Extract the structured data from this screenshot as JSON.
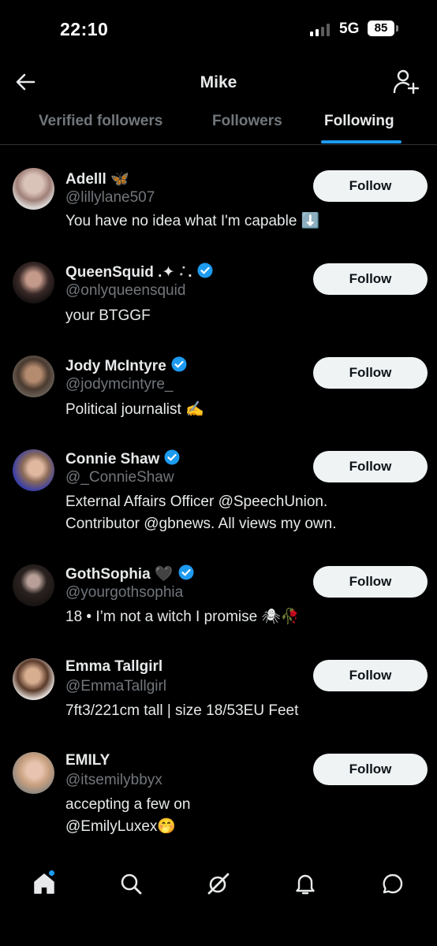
{
  "status_bar": {
    "time": "22:10",
    "network": "5G",
    "battery": "85"
  },
  "header": {
    "title": "Mike"
  },
  "tabs": [
    {
      "label": "Verified followers",
      "active": false
    },
    {
      "label": "Followers",
      "active": false
    },
    {
      "label": "Following",
      "active": true
    }
  ],
  "colors": {
    "accent": "#1d9bf0",
    "background": "#000000",
    "muted": "#71767b",
    "button_bg": "#eff3f4"
  },
  "users": [
    {
      "name": "Adelll 🦋",
      "handle": "@lillylane507",
      "bio": "You have no idea what I'm capable ⬇️",
      "verified": false,
      "follow_label": "Follow"
    },
    {
      "name": "QueenSquid .✦ ݁˖ .",
      "handle": "@onlyqueensquid",
      "bio": "your BTGGF",
      "verified": true,
      "follow_label": "Follow"
    },
    {
      "name": "Jody McIntyre",
      "handle": "@jodymcintyre_",
      "bio": "Political journalist ✍️",
      "verified": true,
      "follow_label": "Follow"
    },
    {
      "name": "Connie Shaw",
      "handle": "@_ConnieShaw",
      "bio": "External Affairs Officer @SpeechUnion. Contributor @gbnews. All views my own.",
      "verified": true,
      "follow_label": "Follow"
    },
    {
      "name": "GothSophia 🖤",
      "handle": "@yourgothsophia",
      "bio": "18 • I’m not a witch I promise 🕷🥀",
      "verified": true,
      "follow_label": "Follow"
    },
    {
      "name": "Emma Tallgirl",
      "handle": "@EmmaTallgirl",
      "bio": "7ft3/221cm tall | size 18/53EU Feet",
      "verified": false,
      "follow_label": "Follow"
    },
    {
      "name": "EMILY",
      "handle": "@itsemilybbyx",
      "bio": "accepting a few on @EmilyLuxex🤭",
      "verified": false,
      "follow_label": "Follow"
    }
  ],
  "bottom_nav": [
    {
      "icon": "home-icon",
      "active": true,
      "has_dot": true
    },
    {
      "icon": "search-icon",
      "active": false
    },
    {
      "icon": "grok-icon",
      "active": false
    },
    {
      "icon": "bell-icon",
      "active": false
    },
    {
      "icon": "messages-icon",
      "active": false
    }
  ]
}
